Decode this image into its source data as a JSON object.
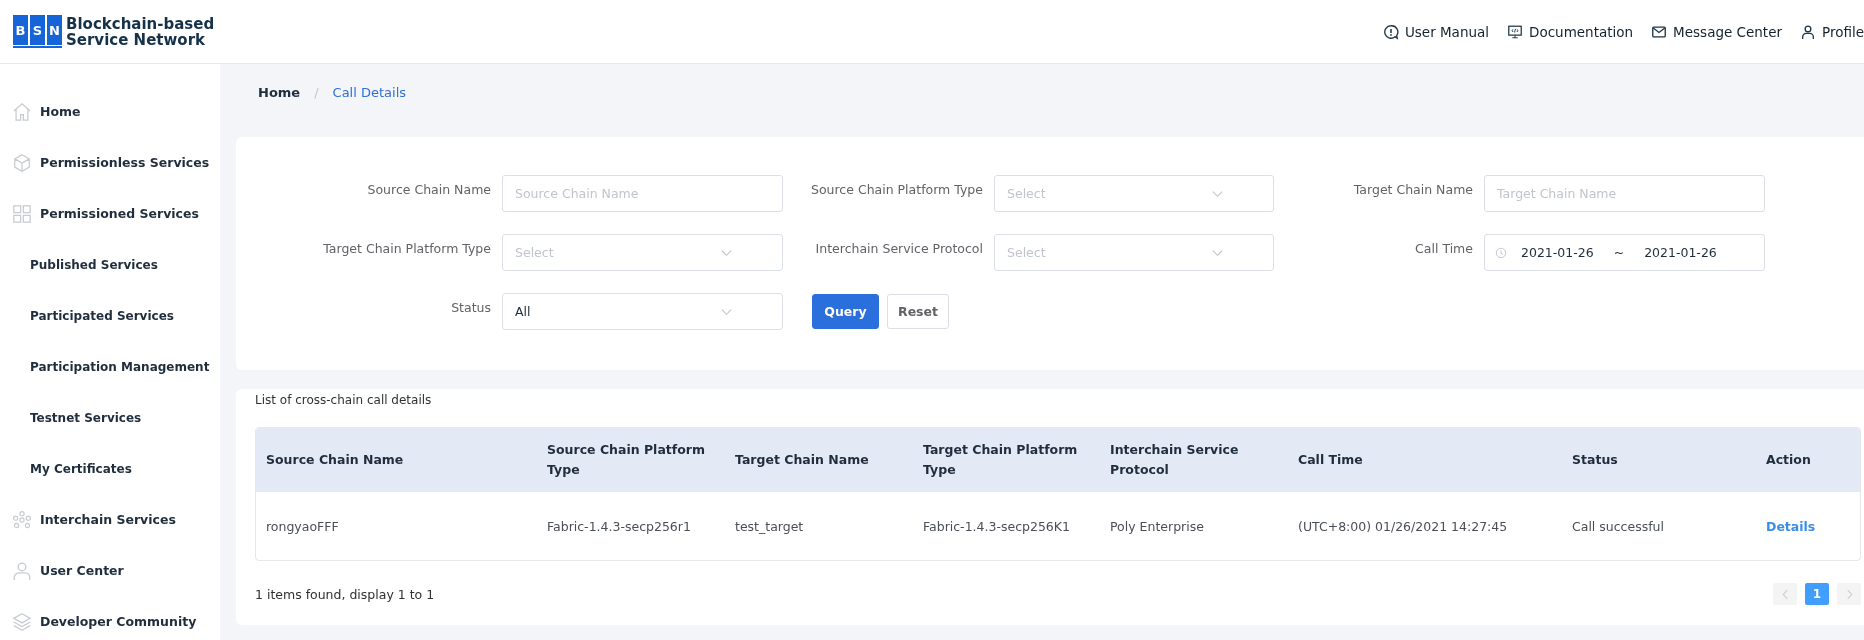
{
  "logo": {
    "letters": [
      "B",
      "S",
      "N"
    ],
    "title_lines": [
      "Blockchain-based",
      "Service Network"
    ]
  },
  "header_links": [
    {
      "label": "User Manual",
      "kind": "manual"
    },
    {
      "label": "Documentation",
      "kind": "docs"
    },
    {
      "label": "Message Center",
      "kind": "message"
    },
    {
      "label": "Profile",
      "kind": "profile"
    }
  ],
  "sidebar": {
    "items": [
      {
        "label": "Home",
        "kind": "home"
      },
      {
        "label": "Permissionless Services",
        "kind": "cube"
      },
      {
        "label": "Permissioned Services",
        "kind": "grid",
        "children": [
          {
            "label": "Published Services"
          },
          {
            "label": "Participated Services"
          },
          {
            "label": "Participation Management"
          },
          {
            "label": "Testnet Services"
          },
          {
            "label": "My Certificates"
          }
        ]
      },
      {
        "label": "Interchain Services",
        "kind": "chain"
      },
      {
        "label": "User Center",
        "kind": "user"
      },
      {
        "label": "Developer Community",
        "kind": "layers"
      }
    ]
  },
  "breadcrumb": [
    {
      "label": "Home",
      "current": false
    },
    {
      "label": "/",
      "kind": "separator"
    },
    {
      "label": "Call Details",
      "current": true
    }
  ],
  "filters": [
    {
      "label": "Source Chain Name",
      "kind": "text",
      "placeholder": "Source Chain Name"
    },
    {
      "label": "Source Chain Platform Type",
      "kind": "select",
      "placeholder": "Select"
    },
    {
      "label": "Target Chain Name",
      "kind": "text",
      "placeholder": "Target Chain Name"
    },
    {
      "label": "Target Chain Platform Type",
      "kind": "select",
      "placeholder": "Select"
    },
    {
      "label": "Interchain Service Protocol",
      "kind": "select",
      "placeholder": "Select"
    },
    {
      "label": "Call Time",
      "kind": "date_range",
      "start": "2021-01-26",
      "separator": "~",
      "end": "2021-01-26"
    },
    {
      "label": "Status",
      "kind": "select",
      "value": "All"
    }
  ],
  "buttons": [
    {
      "label": "Query",
      "kind": "primary"
    },
    {
      "label": "Reset",
      "kind": "default"
    }
  ],
  "table": {
    "title": "List of cross-chain call details",
    "columns": [
      "Source Chain Name",
      "Source Chain Platform Type",
      "Target Chain Name",
      "Target Chain Platform Type",
      "Interchain Service Protocol",
      "Call Time",
      "Status",
      "Action"
    ],
    "rows": [
      {
        "cells": [
          "rongyaoFFF",
          "Fabric-1.4.3-secp256r1",
          "test_target",
          "Fabric-1.4.3-secp256K1",
          "Poly Enterprise",
          "(UTC+8:00) 01/26/2021 14:27:45",
          "Call successful"
        ],
        "action": "Details"
      }
    ]
  },
  "footer": {
    "summary": "1 items found, display 1 to 1",
    "pagination": [
      {
        "kind": "prev",
        "disabled": true
      },
      {
        "kind": "page",
        "label": "1",
        "selected": true
      },
      {
        "kind": "next",
        "disabled": true
      }
    ]
  }
}
